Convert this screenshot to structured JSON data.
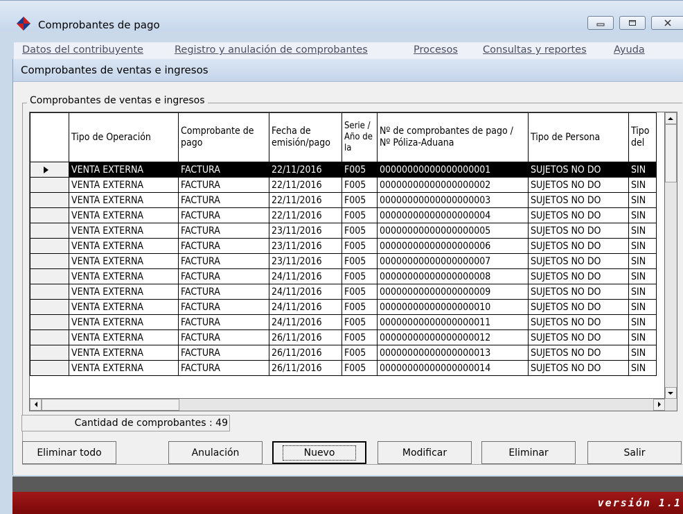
{
  "window": {
    "title": "Comprobantes de pago",
    "minimize_icon": "minimize-icon",
    "restore_icon": "restore-icon",
    "close_icon": "close-icon"
  },
  "menu": [
    "Datos del contribuyente",
    "Registro y anulación de comprobantes",
    "Procesos",
    "Consultas y reportes",
    "Ayuda"
  ],
  "child_window": {
    "title": "Comprobantes de ventas e ingresos",
    "group_label": "Comprobantes de ventas e ingresos"
  },
  "grid": {
    "headers": [
      "Tipo de Operación",
      "Comprobante de pago",
      "Fecha de emisión/pago",
      "Serie / Año de la",
      "Nº de comprobantes de pago / Nº Póliza-Aduana",
      "Tipo de Persona",
      "Tipo del"
    ],
    "selected_row": 0,
    "rows": [
      [
        "VENTA EXTERNA",
        "FACTURA",
        "22/11/2016",
        "F005",
        "00000000000000000001",
        "SUJETOS NO DO",
        "SIN"
      ],
      [
        "VENTA EXTERNA",
        "FACTURA",
        "22/11/2016",
        "F005",
        "00000000000000000002",
        "SUJETOS NO DO",
        "SIN"
      ],
      [
        "VENTA EXTERNA",
        "FACTURA",
        "22/11/2016",
        "F005",
        "00000000000000000003",
        "SUJETOS NO DO",
        "SIN"
      ],
      [
        "VENTA EXTERNA",
        "FACTURA",
        "22/11/2016",
        "F005",
        "00000000000000000004",
        "SUJETOS NO DO",
        "SIN"
      ],
      [
        "VENTA EXTERNA",
        "FACTURA",
        "23/11/2016",
        "F005",
        "00000000000000000005",
        "SUJETOS NO DO",
        "SIN"
      ],
      [
        "VENTA EXTERNA",
        "FACTURA",
        "23/11/2016",
        "F005",
        "00000000000000000006",
        "SUJETOS NO DO",
        "SIN"
      ],
      [
        "VENTA EXTERNA",
        "FACTURA",
        "23/11/2016",
        "F005",
        "00000000000000000007",
        "SUJETOS NO DO",
        "SIN"
      ],
      [
        "VENTA EXTERNA",
        "FACTURA",
        "24/11/2016",
        "F005",
        "00000000000000000008",
        "SUJETOS NO DO",
        "SIN"
      ],
      [
        "VENTA EXTERNA",
        "FACTURA",
        "24/11/2016",
        "F005",
        "00000000000000000009",
        "SUJETOS NO DO",
        "SIN"
      ],
      [
        "VENTA EXTERNA",
        "FACTURA",
        "24/11/2016",
        "F005",
        "00000000000000000010",
        "SUJETOS NO DO",
        "SIN"
      ],
      [
        "VENTA EXTERNA",
        "FACTURA",
        "24/11/2016",
        "F005",
        "00000000000000000011",
        "SUJETOS NO DO",
        "SIN"
      ],
      [
        "VENTA EXTERNA",
        "FACTURA",
        "26/11/2016",
        "F005",
        "00000000000000000012",
        "SUJETOS NO DO",
        "SIN"
      ],
      [
        "VENTA EXTERNA",
        "FACTURA",
        "26/11/2016",
        "F005",
        "00000000000000000013",
        "SUJETOS NO DO",
        "SIN"
      ],
      [
        "VENTA EXTERNA",
        "FACTURA",
        "26/11/2016",
        "F005",
        "00000000000000000014",
        "SUJETOS NO DO",
        "SIN"
      ]
    ]
  },
  "status": {
    "count_text": "Cantidad de comprobantes : 49"
  },
  "buttons": {
    "eliminar_todo": "Eliminar todo",
    "anulacion": "Anulación",
    "nuevo": "Nuevo",
    "modificar": "Modificar",
    "eliminar": "Eliminar",
    "salir": "Salir"
  },
  "footer": {
    "version": "versión 1.1"
  },
  "colors": {
    "selection": "#000000",
    "footer_red": "#8b0e0e"
  }
}
